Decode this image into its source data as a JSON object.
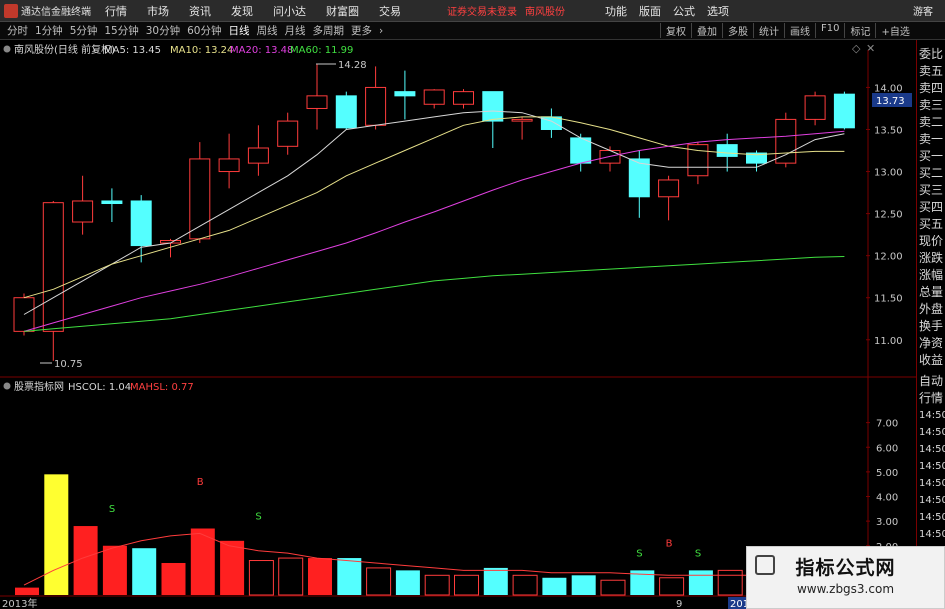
{
  "app": {
    "name": "通达信金融终端"
  },
  "menu": [
    "行情",
    "市场",
    "资讯",
    "发现",
    "问小达",
    "财富圈",
    "交易"
  ],
  "status": {
    "login_notice": "证券交易未登录",
    "stock_name": "南风股份"
  },
  "right_menu": [
    "功能",
    "版面",
    "公式",
    "选项"
  ],
  "guest_label": "游客",
  "periods": [
    {
      "label": "分时",
      "active": false
    },
    {
      "label": "1分钟",
      "active": false
    },
    {
      "label": "5分钟",
      "active": false
    },
    {
      "label": "15分钟",
      "active": false
    },
    {
      "label": "30分钟",
      "active": false
    },
    {
      "label": "60分钟",
      "active": false
    },
    {
      "label": "日线",
      "active": true
    },
    {
      "label": "周线",
      "active": false
    },
    {
      "label": "月线",
      "active": false
    },
    {
      "label": "多周期",
      "active": false
    },
    {
      "label": "更多",
      "active": false
    }
  ],
  "toolbar": [
    "复权",
    "叠加",
    "多股",
    "统计",
    "画线",
    "F10",
    "标记",
    "+自选"
  ],
  "main_chart": {
    "title": "南风股份(日线 前复权)",
    "ma_labels": [
      {
        "text": "MA5: 13.45",
        "color": "#d8d8d8"
      },
      {
        "text": "MA10: 13.24",
        "color": "#e6e08a"
      },
      {
        "text": "MA20: 13.48",
        "color": "#e040e0"
      },
      {
        "text": "MA60: 11.99",
        "color": "#40e040"
      }
    ],
    "high_label": "14.28",
    "low_label": "10.75",
    "current_price": "13.73",
    "y_ticks": [
      "14.00",
      "13.50",
      "13.00",
      "12.50",
      "12.00",
      "11.50",
      "11.00"
    ]
  },
  "sub_chart": {
    "title": "股票指标网",
    "hscol_label": "HSCOL: 1.04",
    "mahsl_label": "MAHSL: 0.77",
    "y_ticks": [
      "7.00",
      "6.00",
      "5.00",
      "4.00",
      "3.00",
      "2.00",
      "1.00"
    ],
    "buy_label": "B",
    "sell_label": "S"
  },
  "x_axis": {
    "start_label": "2013年",
    "mid_label": "9",
    "end_label": "201"
  },
  "right_panel": {
    "items": [
      "委比",
      "卖五",
      "卖四",
      "卖三",
      "卖二",
      "卖一",
      "买一",
      "买二",
      "买三",
      "买四",
      "买五",
      "现价",
      "涨跌",
      "涨幅",
      "总量",
      "外盘",
      "换手",
      "净资",
      "收益"
    ],
    "tabs": [
      "自动",
      "行情"
    ],
    "times": [
      "14:50",
      "14:50",
      "14:50",
      "14:50",
      "14:50",
      "14:50",
      "14:50",
      "14:50",
      "14:50"
    ]
  },
  "watermark": {
    "title": "指标公式网",
    "url": "www.zbgs3.com"
  },
  "chart_data": {
    "type": "candlestick",
    "price_ylim": [
      10.7,
      14.35
    ],
    "candles": [
      {
        "o": 11.1,
        "h": 11.55,
        "l": 11.05,
        "c": 11.5
      },
      {
        "o": 11.1,
        "h": 12.65,
        "l": 10.75,
        "c": 12.63
      },
      {
        "o": 12.4,
        "h": 12.95,
        "l": 12.25,
        "c": 12.65
      },
      {
        "o": 12.65,
        "h": 12.8,
        "l": 12.4,
        "c": 12.62
      },
      {
        "o": 12.65,
        "h": 12.72,
        "l": 11.92,
        "c": 12.12
      },
      {
        "o": 12.15,
        "h": 12.2,
        "l": 11.98,
        "c": 12.18
      },
      {
        "o": 12.2,
        "h": 13.35,
        "l": 12.15,
        "c": 13.15
      },
      {
        "o": 13.0,
        "h": 13.45,
        "l": 12.8,
        "c": 13.15
      },
      {
        "o": 13.1,
        "h": 13.55,
        "l": 12.95,
        "c": 13.28
      },
      {
        "o": 13.3,
        "h": 13.7,
        "l": 13.2,
        "c": 13.6
      },
      {
        "o": 13.75,
        "h": 14.28,
        "l": 13.5,
        "c": 13.9
      },
      {
        "o": 13.9,
        "h": 13.95,
        "l": 13.5,
        "c": 13.52
      },
      {
        "o": 13.55,
        "h": 14.25,
        "l": 13.5,
        "c": 14.0
      },
      {
        "o": 13.95,
        "h": 14.2,
        "l": 13.62,
        "c": 13.9
      },
      {
        "o": 13.8,
        "h": 13.98,
        "l": 13.75,
        "c": 13.97
      },
      {
        "o": 13.8,
        "h": 13.98,
        "l": 13.75,
        "c": 13.95
      },
      {
        "o": 13.95,
        "h": 13.95,
        "l": 13.28,
        "c": 13.6
      },
      {
        "o": 13.6,
        "h": 13.65,
        "l": 13.38,
        "c": 13.62
      },
      {
        "o": 13.65,
        "h": 13.75,
        "l": 13.4,
        "c": 13.5
      },
      {
        "o": 13.4,
        "h": 13.45,
        "l": 13.0,
        "c": 13.1
      },
      {
        "o": 13.1,
        "h": 13.3,
        "l": 13.0,
        "c": 13.25
      },
      {
        "o": 13.15,
        "h": 13.25,
        "l": 12.45,
        "c": 12.7
      },
      {
        "o": 12.7,
        "h": 12.95,
        "l": 12.42,
        "c": 12.9
      },
      {
        "o": 12.95,
        "h": 13.35,
        "l": 12.85,
        "c": 13.32
      },
      {
        "o": 13.32,
        "h": 13.45,
        "l": 13.0,
        "c": 13.18
      },
      {
        "o": 13.22,
        "h": 13.25,
        "l": 13.0,
        "c": 13.1
      },
      {
        "o": 13.1,
        "h": 13.7,
        "l": 13.05,
        "c": 13.62
      },
      {
        "o": 13.62,
        "h": 13.95,
        "l": 13.55,
        "c": 13.9
      },
      {
        "o": 13.92,
        "h": 13.95,
        "l": 13.5,
        "c": 13.52
      }
    ],
    "ma_series": [
      {
        "name": "MA5",
        "color": "#d8d8d8",
        "values": [
          11.3,
          11.5,
          11.7,
          11.9,
          12.1,
          12.15,
          12.35,
          12.55,
          12.75,
          12.95,
          13.2,
          13.5,
          13.55,
          13.6,
          13.65,
          13.7,
          13.72,
          13.7,
          13.6,
          13.4,
          13.25,
          13.1,
          13.05,
          13.05,
          13.05,
          13.05,
          13.2,
          13.38,
          13.45
        ]
      },
      {
        "name": "MA10",
        "color": "#e6e08a",
        "values": [
          11.5,
          11.6,
          11.75,
          11.9,
          12.0,
          12.1,
          12.2,
          12.3,
          12.45,
          12.6,
          12.75,
          12.95,
          13.1,
          13.25,
          13.4,
          13.55,
          13.62,
          13.65,
          13.65,
          13.58,
          13.5,
          13.4,
          13.3,
          13.25,
          13.22,
          13.2,
          13.22,
          13.24,
          13.24
        ]
      },
      {
        "name": "MA20",
        "color": "#e040e0",
        "values": [
          11.1,
          11.2,
          11.3,
          11.4,
          11.5,
          11.58,
          11.66,
          11.75,
          11.85,
          11.95,
          12.05,
          12.15,
          12.27,
          12.4,
          12.52,
          12.65,
          12.78,
          12.9,
          13.0,
          13.1,
          13.18,
          13.25,
          13.3,
          13.35,
          13.38,
          13.4,
          13.42,
          13.45,
          13.48
        ]
      },
      {
        "name": "MA60",
        "color": "#40e040",
        "values": [
          11.1,
          11.13,
          11.16,
          11.19,
          11.22,
          11.25,
          11.3,
          11.35,
          11.4,
          11.45,
          11.5,
          11.55,
          11.6,
          11.65,
          11.7,
          11.73,
          11.76,
          11.78,
          11.8,
          11.82,
          11.84,
          11.86,
          11.88,
          11.9,
          11.92,
          11.94,
          11.96,
          11.98,
          11.99
        ]
      }
    ],
    "indicator": {
      "ylim": [
        0,
        8
      ],
      "hscol": [
        0.3,
        4.9,
        2.8,
        2.0,
        1.9,
        1.3,
        2.7,
        2.2,
        1.4,
        1.5,
        1.5,
        1.5,
        1.1,
        1.0,
        0.8,
        0.8,
        1.1,
        0.8,
        0.7,
        0.8,
        0.6,
        1.0,
        0.7,
        1.0,
        1.0,
        1.1,
        1.5,
        1.8,
        1.0
      ],
      "bar_colors": [
        "red",
        "yellow",
        "red",
        "red",
        "cyan",
        "red",
        "red",
        "red",
        "hollow",
        "hollow",
        "red",
        "cyan",
        "hollow",
        "cyan",
        "hollow",
        "hollow",
        "cyan",
        "hollow",
        "cyan",
        "cyan",
        "hollow",
        "cyan",
        "hollow",
        "cyan",
        "hollow",
        "hollow",
        "hollow",
        "hollow",
        "cyan"
      ],
      "mahsl": [
        0.4,
        1.0,
        1.5,
        1.9,
        2.2,
        2.4,
        2.5,
        2.0,
        1.8,
        1.7,
        1.5,
        1.4,
        1.3,
        1.2,
        1.1,
        1.0,
        1.0,
        1.0,
        0.9,
        0.9,
        0.9,
        0.85,
        0.8,
        0.8,
        0.8,
        0.8,
        0.8,
        0.8,
        0.77
      ],
      "markers": [
        {
          "index": 3,
          "value": 3.2,
          "label": "S"
        },
        {
          "index": 6,
          "value": 4.3,
          "label": "B"
        },
        {
          "index": 8,
          "value": 2.9,
          "label": "S"
        },
        {
          "index": 21,
          "value": 1.4,
          "label": "S"
        },
        {
          "index": 22,
          "value": 1.8,
          "label": "B"
        },
        {
          "index": 23,
          "value": 1.4,
          "label": "S"
        }
      ]
    }
  }
}
